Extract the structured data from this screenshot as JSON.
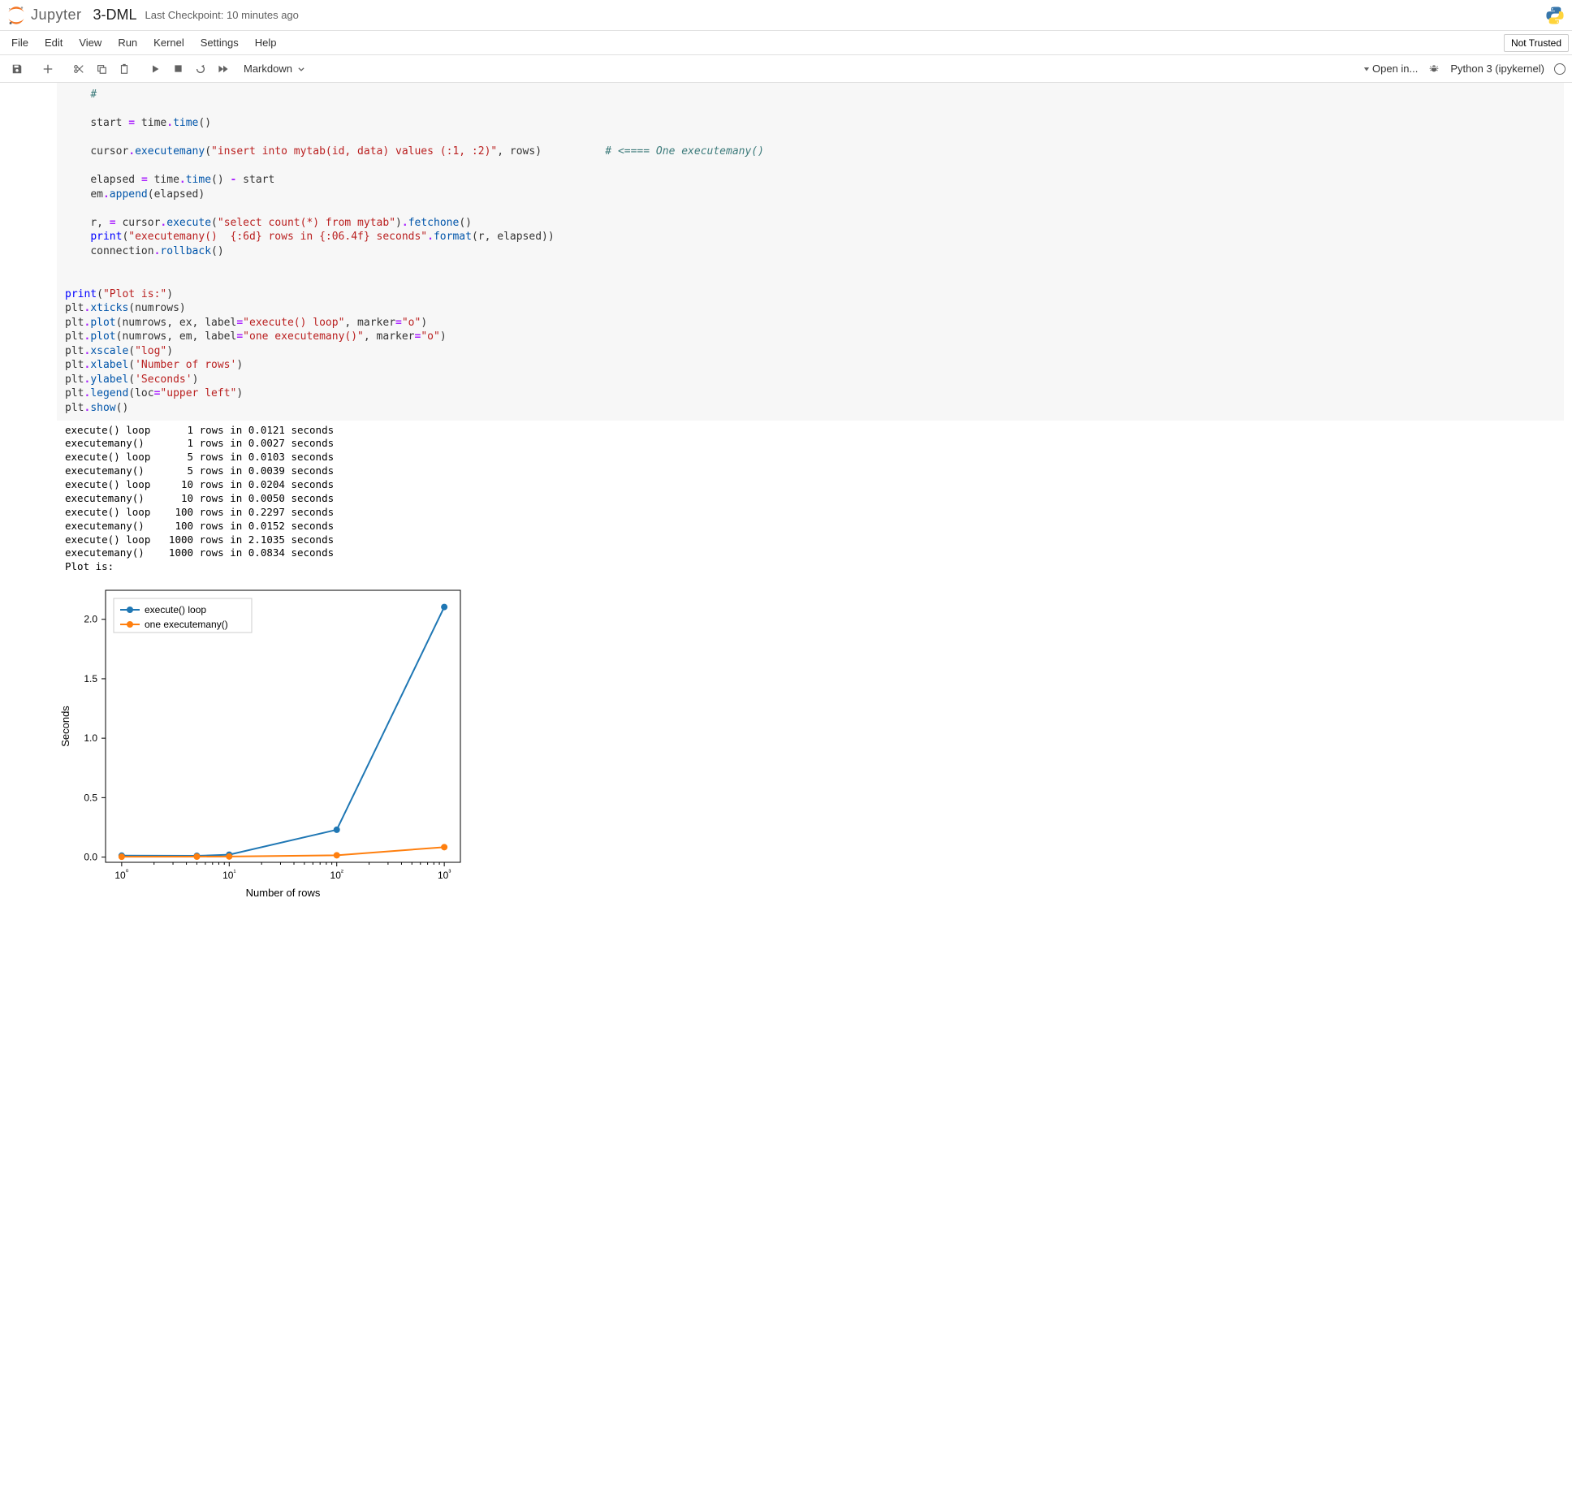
{
  "header": {
    "logo_text": "Jupyter",
    "notebook_name": "3-DML",
    "checkpoint": "Last Checkpoint: 10 minutes ago"
  },
  "menubar": {
    "items": [
      "File",
      "Edit",
      "View",
      "Run",
      "Kernel",
      "Settings",
      "Help"
    ],
    "trust_label": "Not Trusted"
  },
  "toolbar": {
    "cell_type": "Markdown",
    "open_in": "Open in...",
    "kernel_name": "Python 3 (ipykernel)"
  },
  "code": {
    "lines": [
      {
        "indent": 4,
        "tokens": [
          {
            "t": "#",
            "c": "cmt"
          }
        ]
      },
      {
        "blank": true
      },
      {
        "indent": 4,
        "tokens": [
          {
            "t": "start ",
            "c": "c0"
          },
          {
            "t": "=",
            "c": "op"
          },
          {
            "t": " time",
            "c": "c0"
          },
          {
            "t": ".",
            "c": "op"
          },
          {
            "t": "time",
            "c": "attr"
          },
          {
            "t": "()",
            "c": "c0"
          }
        ]
      },
      {
        "blank": true
      },
      {
        "indent": 4,
        "tokens": [
          {
            "t": "cursor",
            "c": "c0"
          },
          {
            "t": ".",
            "c": "op"
          },
          {
            "t": "executemany",
            "c": "attr"
          },
          {
            "t": "(",
            "c": "c0"
          },
          {
            "t": "\"insert into mytab(id, data) values (:1, :2)\"",
            "c": "str"
          },
          {
            "t": ", rows)          ",
            "c": "c0"
          },
          {
            "t": "# <==== One executemany()",
            "c": "cmt"
          }
        ]
      },
      {
        "blank": true
      },
      {
        "indent": 4,
        "tokens": [
          {
            "t": "elapsed ",
            "c": "c0"
          },
          {
            "t": "=",
            "c": "op"
          },
          {
            "t": " time",
            "c": "c0"
          },
          {
            "t": ".",
            "c": "op"
          },
          {
            "t": "time",
            "c": "attr"
          },
          {
            "t": "() ",
            "c": "c0"
          },
          {
            "t": "-",
            "c": "op"
          },
          {
            "t": " start",
            "c": "c0"
          }
        ]
      },
      {
        "indent": 4,
        "tokens": [
          {
            "t": "em",
            "c": "c0"
          },
          {
            "t": ".",
            "c": "op"
          },
          {
            "t": "append",
            "c": "attr"
          },
          {
            "t": "(elapsed)",
            "c": "c0"
          }
        ]
      },
      {
        "blank": true
      },
      {
        "indent": 4,
        "tokens": [
          {
            "t": "r, ",
            "c": "c0"
          },
          {
            "t": "=",
            "c": "op"
          },
          {
            "t": " cursor",
            "c": "c0"
          },
          {
            "t": ".",
            "c": "op"
          },
          {
            "t": "execute",
            "c": "attr"
          },
          {
            "t": "(",
            "c": "c0"
          },
          {
            "t": "\"select count(*) from mytab\"",
            "c": "str"
          },
          {
            "t": ")",
            "c": "c0"
          },
          {
            "t": ".",
            "c": "op"
          },
          {
            "t": "fetchone",
            "c": "attr"
          },
          {
            "t": "()",
            "c": "c0"
          }
        ]
      },
      {
        "indent": 4,
        "tokens": [
          {
            "t": "print",
            "c": "fn"
          },
          {
            "t": "(",
            "c": "c0"
          },
          {
            "t": "\"executemany()  {:6d} rows in {:06.4f} seconds\"",
            "c": "str"
          },
          {
            "t": ".",
            "c": "op"
          },
          {
            "t": "format",
            "c": "attr"
          },
          {
            "t": "(r, elapsed))",
            "c": "c0"
          }
        ]
      },
      {
        "indent": 4,
        "tokens": [
          {
            "t": "connection",
            "c": "c0"
          },
          {
            "t": ".",
            "c": "op"
          },
          {
            "t": "rollback",
            "c": "attr"
          },
          {
            "t": "()",
            "c": "c0"
          }
        ]
      },
      {
        "blank": true
      },
      {
        "blank": true
      },
      {
        "indent": 0,
        "tokens": [
          {
            "t": "print",
            "c": "fn"
          },
          {
            "t": "(",
            "c": "c0"
          },
          {
            "t": "\"Plot is:\"",
            "c": "str"
          },
          {
            "t": ")",
            "c": "c0"
          }
        ]
      },
      {
        "indent": 0,
        "tokens": [
          {
            "t": "plt",
            "c": "c0"
          },
          {
            "t": ".",
            "c": "op"
          },
          {
            "t": "xticks",
            "c": "attr"
          },
          {
            "t": "(numrows)",
            "c": "c0"
          }
        ]
      },
      {
        "indent": 0,
        "tokens": [
          {
            "t": "plt",
            "c": "c0"
          },
          {
            "t": ".",
            "c": "op"
          },
          {
            "t": "plot",
            "c": "attr"
          },
          {
            "t": "(numrows, ex, label",
            "c": "c0"
          },
          {
            "t": "=",
            "c": "op"
          },
          {
            "t": "\"execute() loop\"",
            "c": "str"
          },
          {
            "t": ", marker",
            "c": "c0"
          },
          {
            "t": "=",
            "c": "op"
          },
          {
            "t": "\"o\"",
            "c": "str"
          },
          {
            "t": ")",
            "c": "c0"
          }
        ]
      },
      {
        "indent": 0,
        "tokens": [
          {
            "t": "plt",
            "c": "c0"
          },
          {
            "t": ".",
            "c": "op"
          },
          {
            "t": "plot",
            "c": "attr"
          },
          {
            "t": "(numrows, em, label",
            "c": "c0"
          },
          {
            "t": "=",
            "c": "op"
          },
          {
            "t": "\"one executemany()\"",
            "c": "str"
          },
          {
            "t": ", marker",
            "c": "c0"
          },
          {
            "t": "=",
            "c": "op"
          },
          {
            "t": "\"o\"",
            "c": "str"
          },
          {
            "t": ")",
            "c": "c0"
          }
        ]
      },
      {
        "indent": 0,
        "tokens": [
          {
            "t": "plt",
            "c": "c0"
          },
          {
            "t": ".",
            "c": "op"
          },
          {
            "t": "xscale",
            "c": "attr"
          },
          {
            "t": "(",
            "c": "c0"
          },
          {
            "t": "\"log\"",
            "c": "str"
          },
          {
            "t": ")",
            "c": "c0"
          }
        ]
      },
      {
        "indent": 0,
        "tokens": [
          {
            "t": "plt",
            "c": "c0"
          },
          {
            "t": ".",
            "c": "op"
          },
          {
            "t": "xlabel",
            "c": "attr"
          },
          {
            "t": "(",
            "c": "c0"
          },
          {
            "t": "'Number of rows'",
            "c": "str"
          },
          {
            "t": ")",
            "c": "c0"
          }
        ]
      },
      {
        "indent": 0,
        "tokens": [
          {
            "t": "plt",
            "c": "c0"
          },
          {
            "t": ".",
            "c": "op"
          },
          {
            "t": "ylabel",
            "c": "attr"
          },
          {
            "t": "(",
            "c": "c0"
          },
          {
            "t": "'Seconds'",
            "c": "str"
          },
          {
            "t": ")",
            "c": "c0"
          }
        ]
      },
      {
        "indent": 0,
        "tokens": [
          {
            "t": "plt",
            "c": "c0"
          },
          {
            "t": ".",
            "c": "op"
          },
          {
            "t": "legend",
            "c": "attr"
          },
          {
            "t": "(loc",
            "c": "c0"
          },
          {
            "t": "=",
            "c": "op"
          },
          {
            "t": "\"upper left\"",
            "c": "str"
          },
          {
            "t": ")",
            "c": "c0"
          }
        ]
      },
      {
        "indent": 0,
        "tokens": [
          {
            "t": "plt",
            "c": "c0"
          },
          {
            "t": ".",
            "c": "op"
          },
          {
            "t": "show",
            "c": "attr"
          },
          {
            "t": "()",
            "c": "c0"
          }
        ]
      }
    ]
  },
  "output": {
    "lines": [
      "execute() loop      1 rows in 0.0121 seconds",
      "executemany()       1 rows in 0.0027 seconds",
      "execute() loop      5 rows in 0.0103 seconds",
      "executemany()       5 rows in 0.0039 seconds",
      "execute() loop     10 rows in 0.0204 seconds",
      "executemany()      10 rows in 0.0050 seconds",
      "execute() loop    100 rows in 0.2297 seconds",
      "executemany()     100 rows in 0.0152 seconds",
      "execute() loop   1000 rows in 2.1035 seconds",
      "executemany()    1000 rows in 0.0834 seconds",
      "Plot is:"
    ]
  },
  "chart_data": {
    "type": "line",
    "x": [
      1,
      5,
      10,
      100,
      1000
    ],
    "series": [
      {
        "name": "execute() loop",
        "values": [
          0.0121,
          0.0103,
          0.0204,
          0.2297,
          2.1035
        ],
        "color": "#1f77b4"
      },
      {
        "name": "one executemany()",
        "values": [
          0.0027,
          0.0039,
          0.005,
          0.0152,
          0.0834
        ],
        "color": "#ff7f0e"
      }
    ],
    "xlabel": "Number of rows",
    "ylabel": "Seconds",
    "xscale": "log",
    "yticks": [
      0.0,
      0.5,
      1.0,
      1.5,
      2.0
    ],
    "xtick_labels": [
      "10⁰",
      "10¹",
      "10²",
      "10³"
    ],
    "xtick_values": [
      1,
      10,
      100,
      1000
    ],
    "legend_loc": "upper left"
  }
}
